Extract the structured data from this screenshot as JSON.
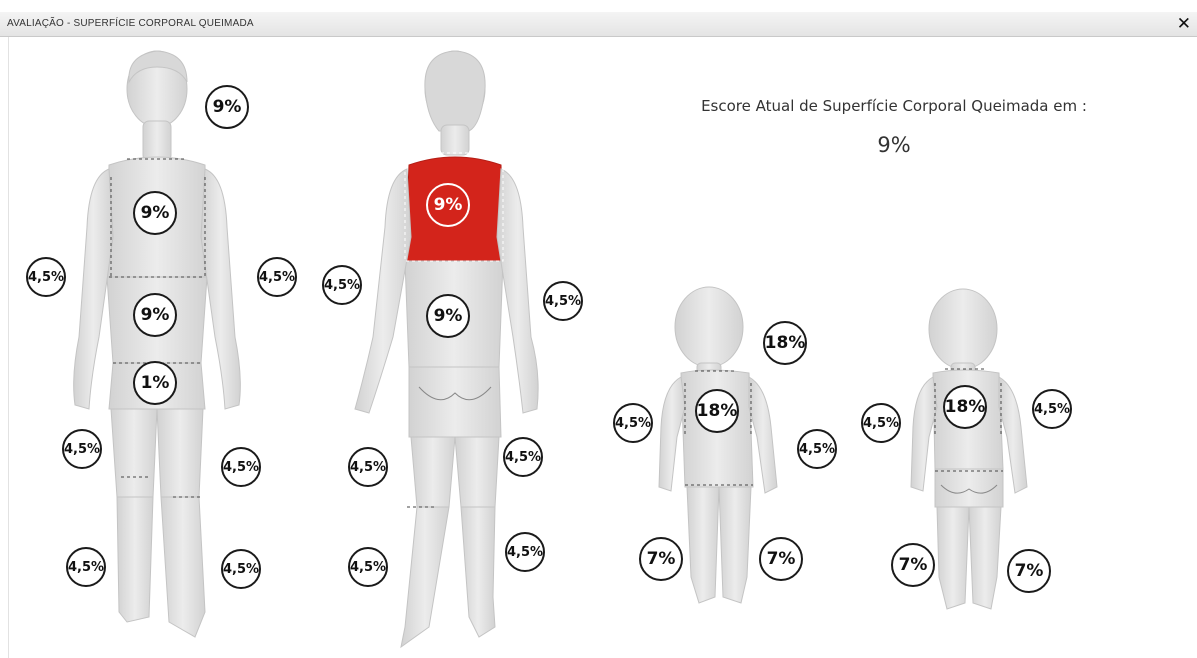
{
  "window": {
    "title": "AVALIAÇÃO - SUPERFÍCIE CORPORAL QUEIMADA",
    "close_label": "✕"
  },
  "score": {
    "label": "Escore Atual de Superfície Corporal Queimada em :",
    "value": "9%"
  },
  "colors": {
    "body": "#e3e3e3",
    "burn": "#d3241b",
    "outline": "#1a1a1a"
  },
  "adult_front": {
    "head": "9%",
    "chest": "9%",
    "abdomen": "9%",
    "genital": "1%",
    "left_arm": "4,5%",
    "right_arm": "4,5%",
    "left_thigh": "4,5%",
    "right_thigh": "4,5%",
    "left_leg": "4,5%",
    "right_leg": "4,5%"
  },
  "adult_back": {
    "upper_back": "9%",
    "lower_back": "9%",
    "left_arm": "4,5%",
    "right_arm": "4,5%",
    "left_thigh": "4,5%",
    "right_thigh": "4,5%",
    "left_leg": "4,5%",
    "right_leg": "4,5%",
    "selected_region": "upper_back"
  },
  "child_front": {
    "head": "18%",
    "trunk": "18%",
    "left_arm": "4,5%",
    "right_arm": "4,5%",
    "left_leg": "7%",
    "right_leg": "7%"
  },
  "child_back": {
    "trunk": "18%",
    "left_arm": "4,5%",
    "right_arm": "4,5%",
    "left_leg": "7%",
    "right_leg": "7%"
  }
}
